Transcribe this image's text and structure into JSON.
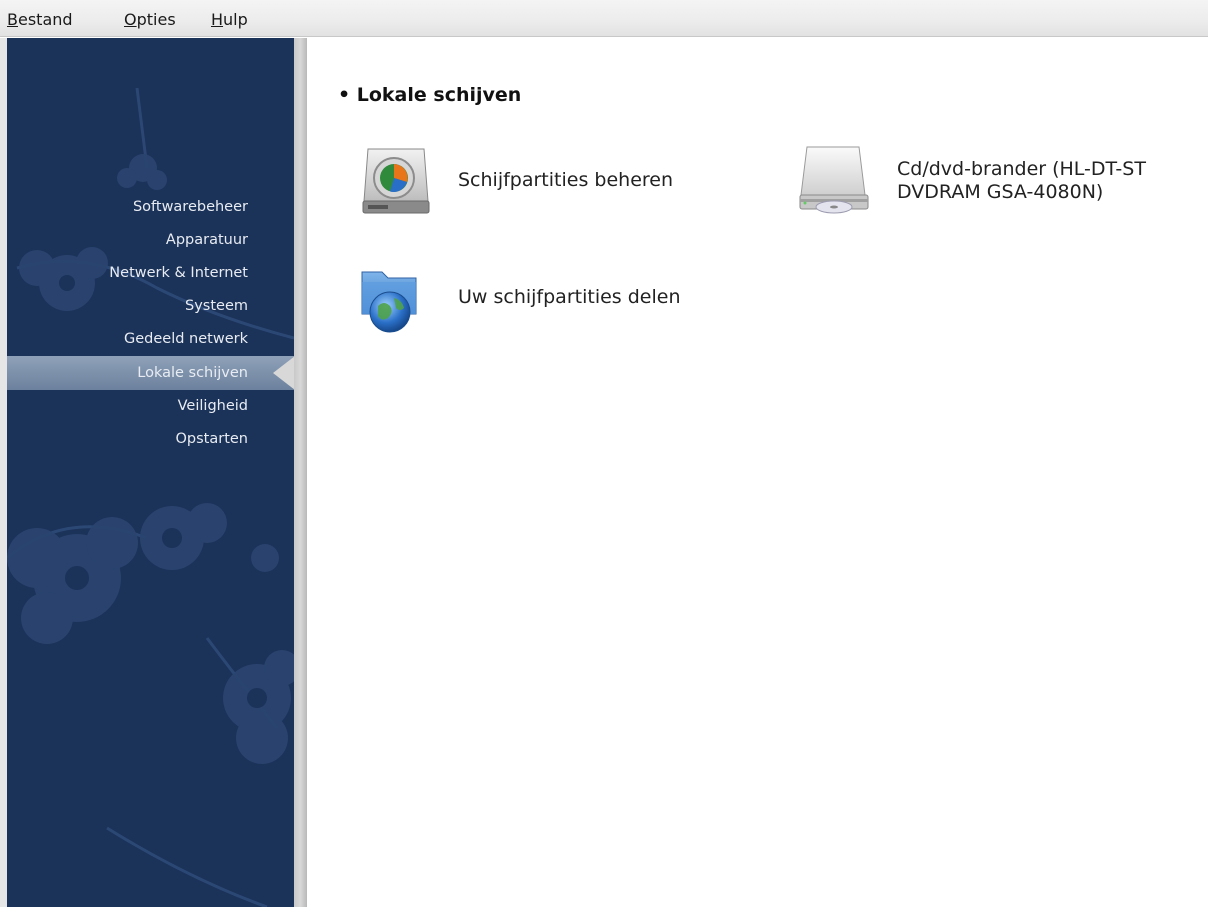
{
  "menubar": {
    "items": [
      {
        "label": "Bestand",
        "mnemonic": "B",
        "rest": "estand"
      },
      {
        "label": "Opties",
        "mnemonic": "O",
        "rest": "pties"
      },
      {
        "label": "Hulp",
        "mnemonic": "H",
        "rest": "ulp"
      }
    ]
  },
  "sidebar": {
    "items": [
      {
        "label": "Softwarebeheer"
      },
      {
        "label": "Apparatuur"
      },
      {
        "label": "Netwerk & Internet"
      },
      {
        "label": "Systeem"
      },
      {
        "label": "Gedeeld netwerk"
      },
      {
        "label": "Lokale schijven",
        "active": true
      },
      {
        "label": "Veiligheid"
      },
      {
        "label": "Opstarten"
      }
    ]
  },
  "main": {
    "section_title": "• Lokale schijven",
    "tools": [
      {
        "label": "Schijfpartities beheren",
        "icon": "harddisk-partition-icon"
      },
      {
        "label_line1": "Cd/dvd-brander (HL-DT-ST",
        "label_line2": "DVDRAM GSA-4080N)",
        "icon": "optical-drive-icon"
      },
      {
        "label": "Uw schijfpartities delen",
        "icon": "network-folder-icon"
      }
    ]
  },
  "colors": {
    "sidebar_bg": "#1b3259",
    "sidebar_active": "#7d91ac",
    "sidebar_text": "#e8ecf2"
  }
}
